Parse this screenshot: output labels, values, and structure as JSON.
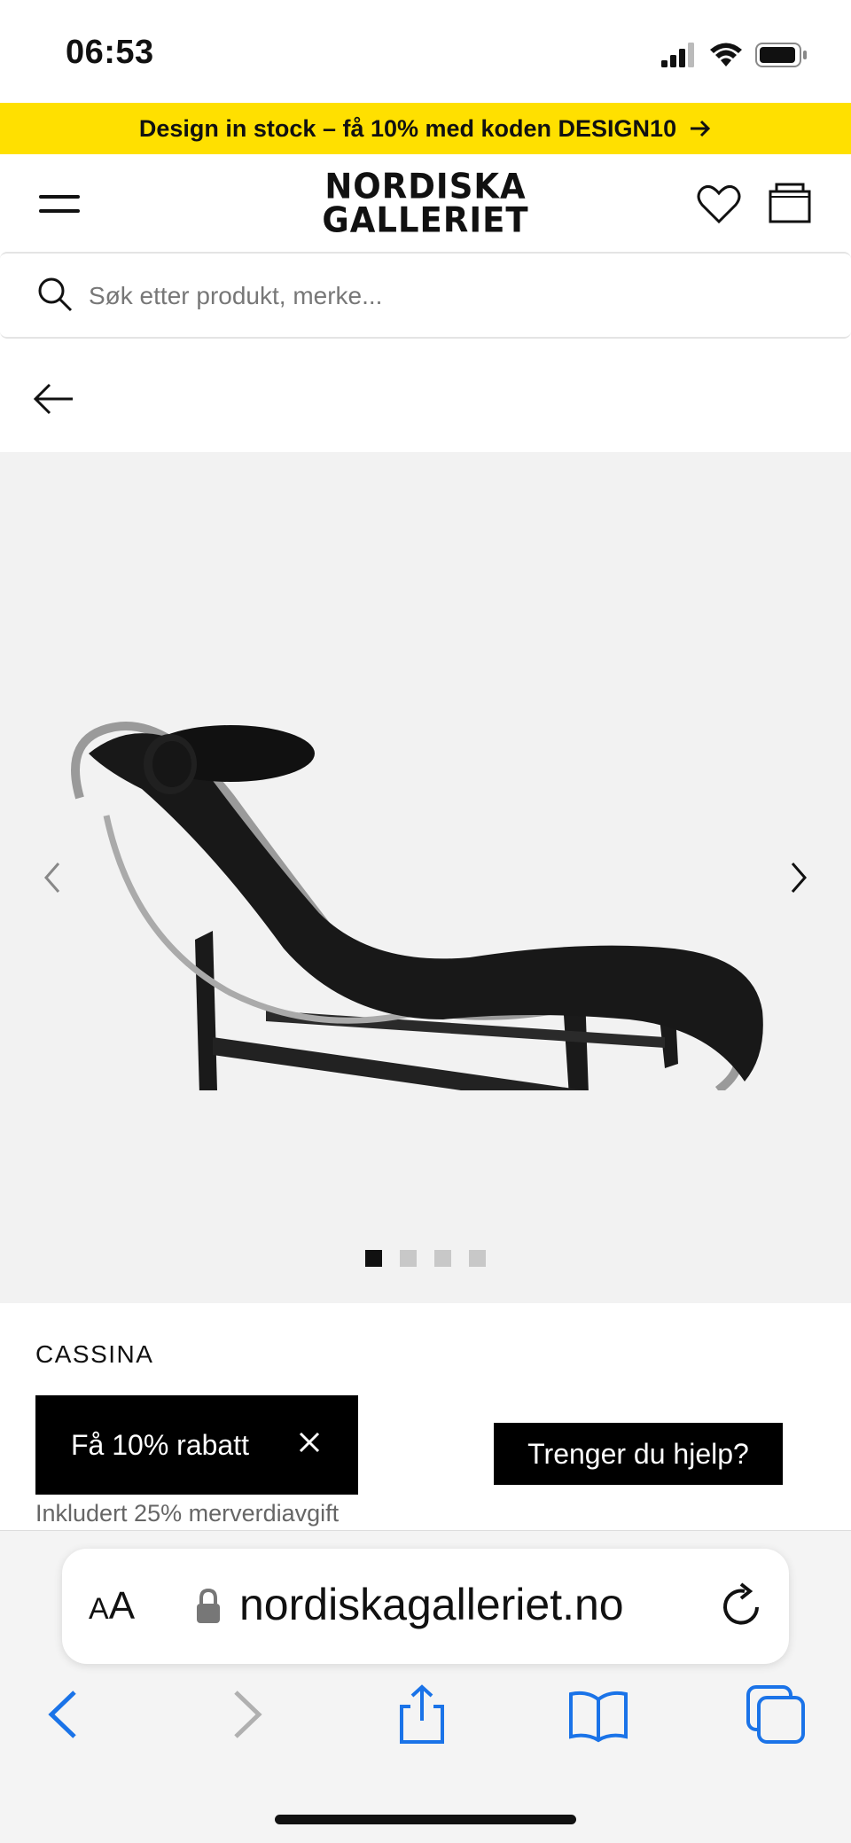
{
  "status": {
    "time": "06:53"
  },
  "promo": {
    "text": "Design in stock – få 10% med koden DESIGN10"
  },
  "header": {
    "logo_line1": "NORDISKA",
    "logo_line2": "GALLERIET"
  },
  "search": {
    "placeholder": "Søk etter produkt, merke..."
  },
  "gallery": {
    "image_count": 4,
    "active_index": 0
  },
  "product": {
    "brand": "CASSINA",
    "vat_note": "Inkludert 25% merverdiavgift"
  },
  "discount": {
    "label": "Få 10% rabatt"
  },
  "help": {
    "label": "Trenger du hjelp?"
  },
  "browser": {
    "text_size_small": "A",
    "text_size_large": "A",
    "url": "nordiskagalleriet.no"
  },
  "colors": {
    "promo_bg": "#ffe000",
    "safari_blue": "#1a73e8",
    "gallery_bg": "#f2f2f2"
  }
}
